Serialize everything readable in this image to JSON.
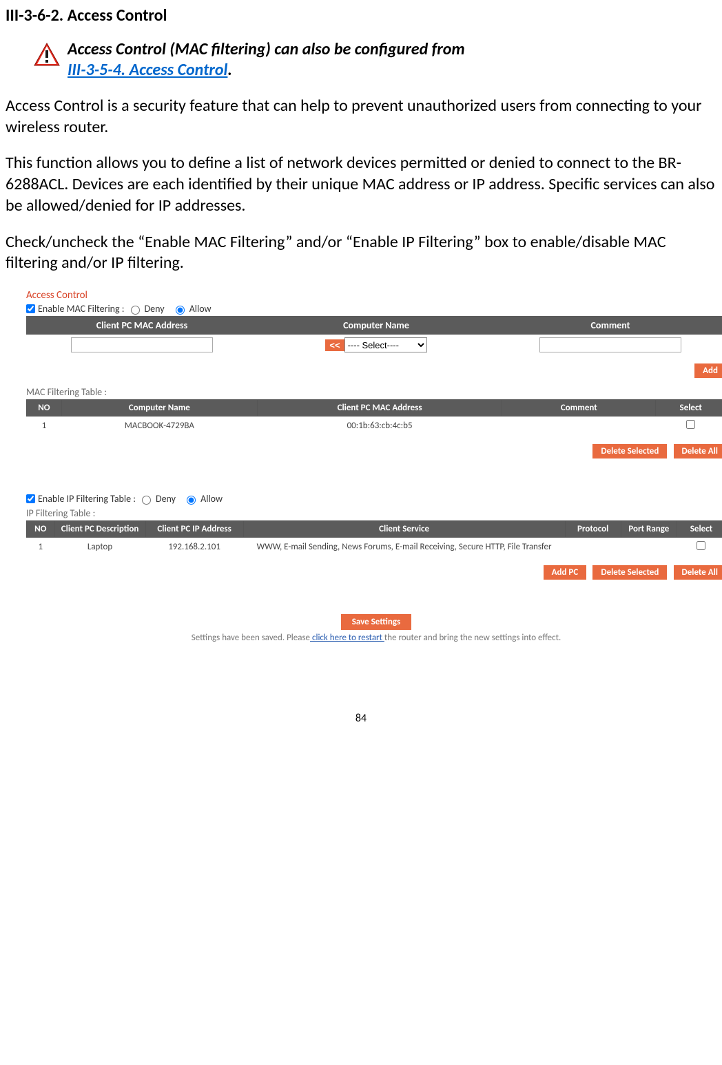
{
  "heading": "III-3-6-2.    Access Control",
  "note": {
    "line1": "Access Control (MAC filtering) can also be configured from",
    "link": "III-3-5-4. Access Control",
    "tail": "."
  },
  "para1": "Access Control is a security feature that can help to prevent unauthorized users from connecting to your wireless router.",
  "para2": "This function allows you to define a list of network devices permitted or denied to connect to the BR-6288ACL. Devices are each identified by their unique MAC address or IP address. Specific services can also be allowed/denied for IP addresses.",
  "para3": "Check/uncheck the “Enable MAC Filtering” and/or “Enable IP Filtering” box to enable/disable MAC filtering and/or IP filtering.",
  "panel": {
    "title": "Access Control",
    "mac": {
      "enable_label": "Enable  MAC Filtering :",
      "deny": "Deny",
      "allow": "Allow",
      "hdr1": "Client PC  MAC Address",
      "hdr2": "Computer Name",
      "hdr3": "Comment",
      "select_button": "<<",
      "select_placeholder": "---- Select----",
      "add": "Add",
      "table_label": "MAC Filtering  Table :",
      "th_no": "NO",
      "th_name": "Computer Name",
      "th_mac": "Client PC  MAC Address",
      "th_comment": "Comment",
      "th_select": "Select",
      "rows": [
        {
          "no": "1",
          "name": "MACBOOK-4729BA",
          "mac": "00:1b:63:cb:4c:b5",
          "comment": ""
        }
      ],
      "delete_selected": "Delete Selected",
      "delete_all": "Delete All"
    },
    "ip": {
      "enable_label": "Enable  IP Filtering Table :",
      "deny": "Deny",
      "allow": "Allow",
      "table_label": "IP Filtering Table :",
      "th_no": "NO",
      "th_desc": "Client PC Description",
      "th_ip": "Client PC  IP Address",
      "th_service": "Client Service",
      "th_proto": "Protocol",
      "th_port": "Port Range",
      "th_select": "Select",
      "rows": [
        {
          "no": "1",
          "desc": "Laptop",
          "ip": "192.168.2.101",
          "service": "WWW, E-mail Sending, News Forums, E-mail Receiving, Secure HTTP, File Transfer",
          "proto": "",
          "port": ""
        }
      ],
      "add_pc": "Add PC",
      "delete_selected": "Delete Selected",
      "delete_all": "Delete All"
    },
    "save": "Save Settings",
    "saved_msg_pre": "Settings have been saved. Please",
    "saved_msg_link": " click here to restart ",
    "saved_msg_post": "the router and bring the new settings into effect."
  },
  "page_number": "84"
}
